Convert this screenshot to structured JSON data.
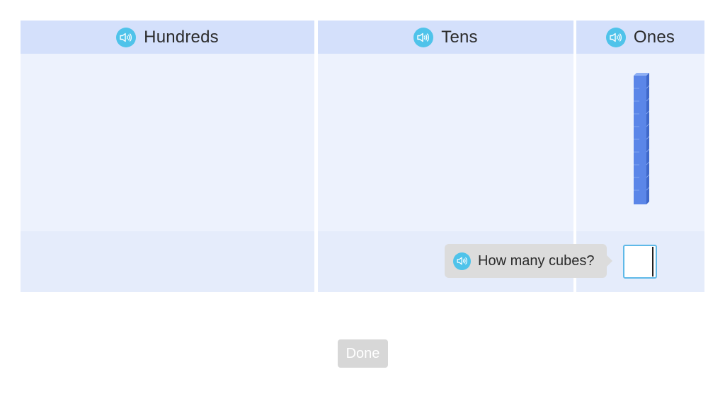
{
  "place_value_chart": {
    "columns": [
      {
        "label": "Hundreds",
        "icon": "speaker-icon"
      },
      {
        "label": "Tens",
        "icon": "speaker-icon"
      },
      {
        "label": "Ones",
        "icon": "speaker-icon"
      }
    ],
    "ones_column_blocks": 1
  },
  "prompt": {
    "text": "How many cubes?",
    "icon": "speaker-icon"
  },
  "answer": {
    "value": ""
  },
  "done_button": {
    "label": "Done"
  },
  "colors": {
    "header": "#d4e0fb",
    "body": "#edf2fd",
    "footer": "#e5ecfb",
    "speaker": "#4fc3ea",
    "rod": "#5b86e8",
    "input_border": "#5fb9e8",
    "done_button": "#d7d7d7",
    "prompt_bubble": "#dcdcdc"
  }
}
